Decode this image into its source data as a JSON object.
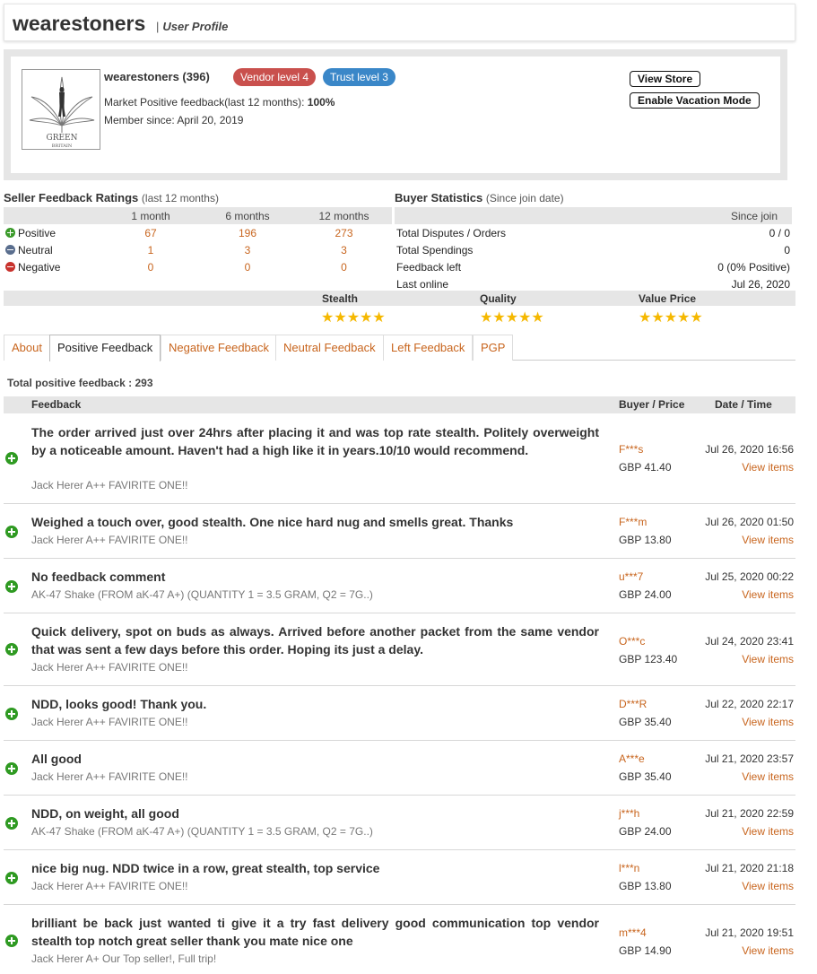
{
  "header": {
    "username": "wearestoners",
    "subtitle": "User Profile",
    "separator": "|"
  },
  "profile": {
    "name_line": "wearestoners (396)",
    "vendor_level": "Vendor level 4",
    "trust_level": "Trust level 3",
    "feedback_label": "Market Positive feedback(last 12 months): ",
    "feedback_value": "100%",
    "member_since": "Member since: April 20, 2019",
    "view_store": "View Store",
    "vacation": "Enable Vacation Mode",
    "avatar_text_1": "GREEN",
    "avatar_text_2": "BRITAIN"
  },
  "seller_ratings": {
    "title": "Seller Feedback Ratings",
    "note": "(last 12 months)",
    "columns": [
      "1 month",
      "6 months",
      "12 months"
    ],
    "rows": [
      {
        "label": "Positive",
        "values": [
          "67",
          "196",
          "273"
        ]
      },
      {
        "label": "Neutral",
        "values": [
          "1",
          "3",
          "3"
        ]
      },
      {
        "label": "Negative",
        "values": [
          "0",
          "0",
          "0"
        ]
      }
    ]
  },
  "buyer_stats": {
    "title": "Buyer Statistics",
    "note": "(Since join date)",
    "column": "Since join",
    "rows": [
      {
        "label": "Total Disputes / Orders",
        "value": "0 / 0"
      },
      {
        "label": "Total Spendings",
        "value": "0"
      },
      {
        "label": "Feedback left",
        "value": "0 (0% Positive)"
      },
      {
        "label": "Last online",
        "value": "Jul 26, 2020"
      }
    ]
  },
  "ratings": [
    {
      "label": "Stealth",
      "stars": "★★★★★",
      "value": 5
    },
    {
      "label": "Quality",
      "stars": "★★★★★",
      "value": 5
    },
    {
      "label": "Value Price",
      "stars": "★★★★★",
      "value": 5
    }
  ],
  "tabs": [
    "About",
    "Positive Feedback",
    "Negative Feedback",
    "Neutral Feedback",
    "Left Feedback",
    "PGP"
  ],
  "total_feedback": "Total positive feedback : 293",
  "feedback_headers": {
    "feedback": "Feedback",
    "buyer": "Buyer / Price",
    "date": "Date / Time"
  },
  "feedback": [
    {
      "comment": "The order arrived just over 24hrs after placing it and was top rate stealth. Politely overweight by a noticeable amount. Haven't had a high like it in years.10/10 would recommend.",
      "item": "Jack Herer A++ FAVIRITE ONE!!",
      "buyer": "F***s",
      "price": "GBP 41.40",
      "date": "Jul 26, 2020 16:56",
      "view": "View items"
    },
    {
      "comment": "Weighed a touch over, good stealth. One nice hard nug and smells great. Thanks",
      "item": "Jack Herer A++ FAVIRITE ONE!!",
      "buyer": "F***m",
      "price": "GBP 13.80",
      "date": "Jul 26, 2020 01:50",
      "view": "View items"
    },
    {
      "comment": "No feedback comment",
      "item": "AK-47 Shake (FROM aK-47 A+) (QUANTITY 1 = 3.5 GRAM, Q2 = 7G..)",
      "buyer": "u***7",
      "price": "GBP 24.00",
      "date": "Jul 25, 2020 00:22",
      "view": "View items"
    },
    {
      "comment": "Quick delivery, spot on buds as always. Arrived before another packet from the same vendor that was sent a few days before this order. Hoping its just a delay.",
      "item": "Jack Herer A++ FAVIRITE ONE!!",
      "buyer": "O***c",
      "price": "GBP 123.40",
      "date": "Jul 24, 2020 23:41",
      "view": "View items"
    },
    {
      "comment": "NDD, looks good! Thank you.",
      "item": "Jack Herer A++ FAVIRITE ONE!!",
      "buyer": "D***R",
      "price": "GBP 35.40",
      "date": "Jul 22, 2020 22:17",
      "view": "View items"
    },
    {
      "comment": "All good",
      "item": "Jack Herer A++ FAVIRITE ONE!!",
      "buyer": "A***e",
      "price": "GBP 35.40",
      "date": "Jul 21, 2020 23:57",
      "view": "View items"
    },
    {
      "comment": "NDD, on weight, all good",
      "item": "AK-47 Shake (FROM aK-47 A+) (QUANTITY 1 = 3.5 GRAM, Q2 = 7G..)",
      "buyer": "j***h",
      "price": "GBP 24.00",
      "date": "Jul 21, 2020 22:59",
      "view": "View items"
    },
    {
      "comment": "nice big nug. NDD twice in a row, great stealth, top service",
      "item": "Jack Herer A++ FAVIRITE ONE!!",
      "buyer": "l***n",
      "price": "GBP 13.80",
      "date": "Jul 21, 2020 21:18",
      "view": "View items"
    },
    {
      "comment": "brilliant be back just wanted ti give it a try fast delivery good communication top vendor stealth top notch great seller thank you mate nice one",
      "item": "Jack Herer A+ Our Top seller!, Full trip!",
      "buyer": "m***4",
      "price": "GBP 14.90",
      "date": "Jul 21, 2020 19:51",
      "view": "View items"
    }
  ]
}
